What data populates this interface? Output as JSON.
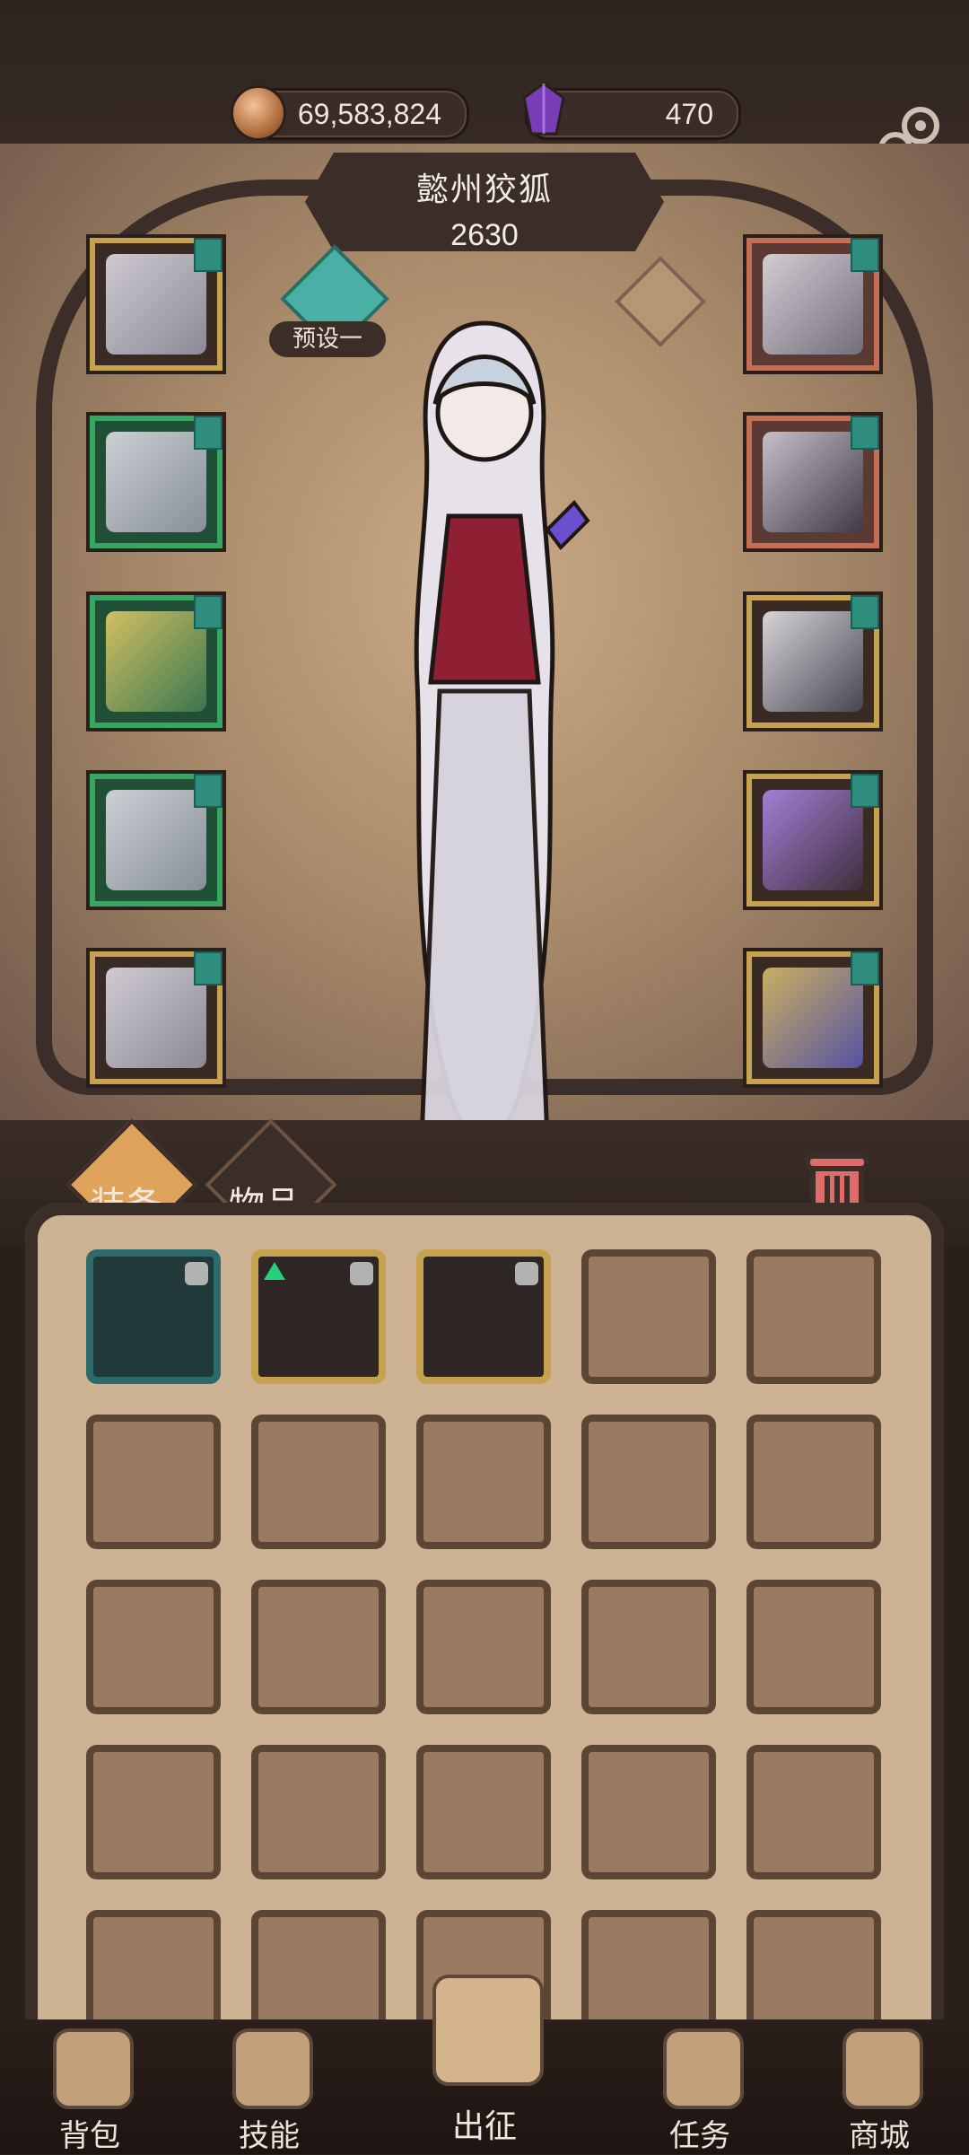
{
  "currency": {
    "gold_amount": "69,583,824",
    "gem_amount": "470"
  },
  "header": {
    "character_name": "懿州狡狐",
    "power": "2630"
  },
  "preset": {
    "label": "预设一"
  },
  "tabs": {
    "equipment": "装备",
    "items": "物品"
  },
  "bottom_nav": [
    {
      "label": "背包"
    },
    {
      "label": "技能"
    },
    {
      "label": "出征"
    },
    {
      "label": "任务"
    },
    {
      "label": "商城"
    }
  ],
  "colors": {
    "gold_frame": "#c6a24e",
    "green_frame": "#36a763",
    "copper_frame": "#c46e56",
    "teal_tag": "#2f8d7d",
    "trash_red": "#e06b6b"
  },
  "icons": {
    "gold": "gold-coin-icon",
    "gem": "purple-gem-icon",
    "settings": "gear-icon",
    "info": "info-diamond-icon",
    "trash": "trash-icon"
  }
}
